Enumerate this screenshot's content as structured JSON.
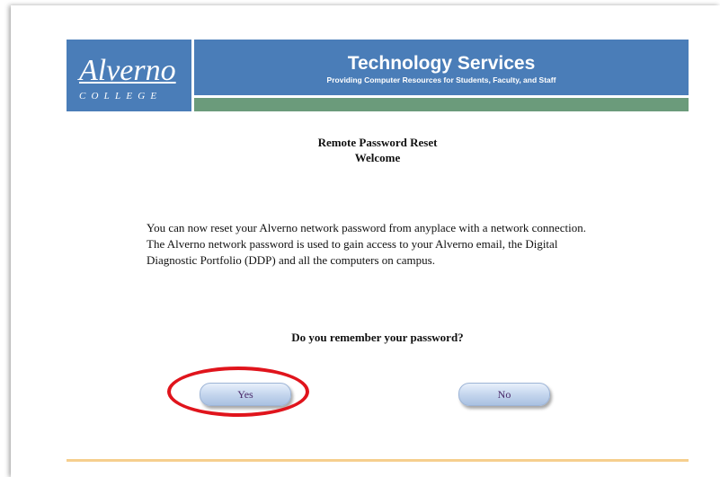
{
  "header": {
    "logo_name": "Alverno",
    "logo_sub": "COLLEGE",
    "title": "Technology Services",
    "subtitle": "Providing Computer Resources for Students, Faculty, and Staff"
  },
  "page": {
    "title": "Remote Password Reset",
    "subtitle": "Welcome",
    "intro": "You can now reset your Alverno network password from anyplace with a network connection. The Alverno network password is used to gain access to your Alverno email, the Digital Diagnostic Portfolio (DDP) and all the computers on campus.",
    "question": "Do you remember your password?"
  },
  "buttons": {
    "yes_label": "Yes",
    "no_label": "No"
  },
  "colors": {
    "banner_blue": "#4a7db8",
    "banner_green": "#6b9b7b",
    "highlight_red": "#e0141c",
    "footer_line": "#f6cf8e"
  }
}
